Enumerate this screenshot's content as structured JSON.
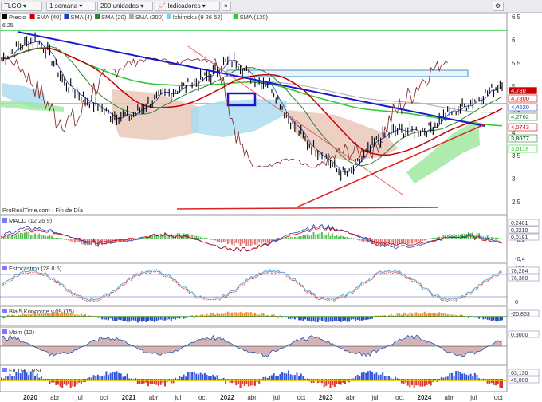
{
  "toolbar": {
    "symbol": "TLGO",
    "period": "1 semana",
    "units": "200 unidades",
    "indicators": "Indicadores",
    "close_label": "×",
    "settings_label": "⚙",
    "expand_label": "▸"
  },
  "legend": [
    {
      "label": "Precio",
      "color": "#000000"
    },
    {
      "label": "SMA (40)",
      "color": "#cc0000"
    },
    {
      "label": "SMA (4)",
      "color": "#1f3fbf"
    },
    {
      "label": "SMA (20)",
      "color": "#2e7d32"
    },
    {
      "label": "SMA (200)",
      "color": "#aaaaaa"
    },
    {
      "label": "Ichimoku (9 26 52)",
      "color": "#7fd3e8"
    },
    {
      "label": "SMA (120)",
      "color": "#33cc33"
    }
  ],
  "main": {
    "source_label": "ProRealTime.com - Fin de Día",
    "top_left_value": "6.25",
    "axis_ticks": [
      "6,5",
      "6",
      "5,5",
      "5",
      "4,5",
      "4",
      "3,5",
      "3",
      "2,5"
    ],
    "price_tags": [
      {
        "text": "4,780",
        "bg": "#cc0000",
        "fg": "#ffffff"
      },
      {
        "text": "4,7800",
        "bg": "#ffffff",
        "fg": "#cc0000"
      },
      {
        "text": "4,4620",
        "bg": "#ffffff",
        "fg": "#1f3fbf"
      },
      {
        "text": "4,2762",
        "bg": "#ffffff",
        "fg": "#2e7d32"
      },
      {
        "text": "4,0743",
        "bg": "#ffffff",
        "fg": "#cc0000"
      },
      {
        "text": "3,8077",
        "bg": "#ffffff",
        "fg": "#2e7d32"
      },
      {
        "text": "3,6118",
        "bg": "#ffffff",
        "fg": "#33cc33"
      }
    ]
  },
  "panels": [
    {
      "title": "MACD (12 26 9)",
      "ticks": [
        "0",
        "-0,2",
        "-0,4"
      ],
      "values": [
        "0,2401",
        "0,2210",
        "0,0191"
      ]
    },
    {
      "title": "Estocástico (28 8 5)",
      "ticks": [
        "100",
        "0"
      ],
      "values": [
        "78,284",
        "76,360"
      ]
    },
    {
      "title": "Blai5 Koncorde v.09 (15)",
      "ticks": [],
      "values": [
        "-20,863"
      ]
    },
    {
      "title": "Mom (12)",
      "ticks": [],
      "values": [
        "0,3000"
      ]
    },
    {
      "title": "FILTRO RSI",
      "ticks": [],
      "values": [
        "63,130",
        "45,000"
      ]
    }
  ],
  "xaxis": {
    "labels": [
      "2020",
      "abr",
      "jul",
      "oct",
      "2021",
      "abr",
      "jul",
      "oct",
      "2022",
      "abr",
      "jul",
      "oct",
      "2023",
      "abr",
      "jul",
      "oct",
      "2024",
      "abr",
      "jul",
      "oct"
    ]
  },
  "colors": {
    "price": "#000000",
    "trendline_blue": "#1a1acc",
    "support_red": "#e02020",
    "cloud_green": "#9fe8a0",
    "cloud_blue": "#a8dcf0",
    "cloud_brown": "#e8c8b8"
  }
}
